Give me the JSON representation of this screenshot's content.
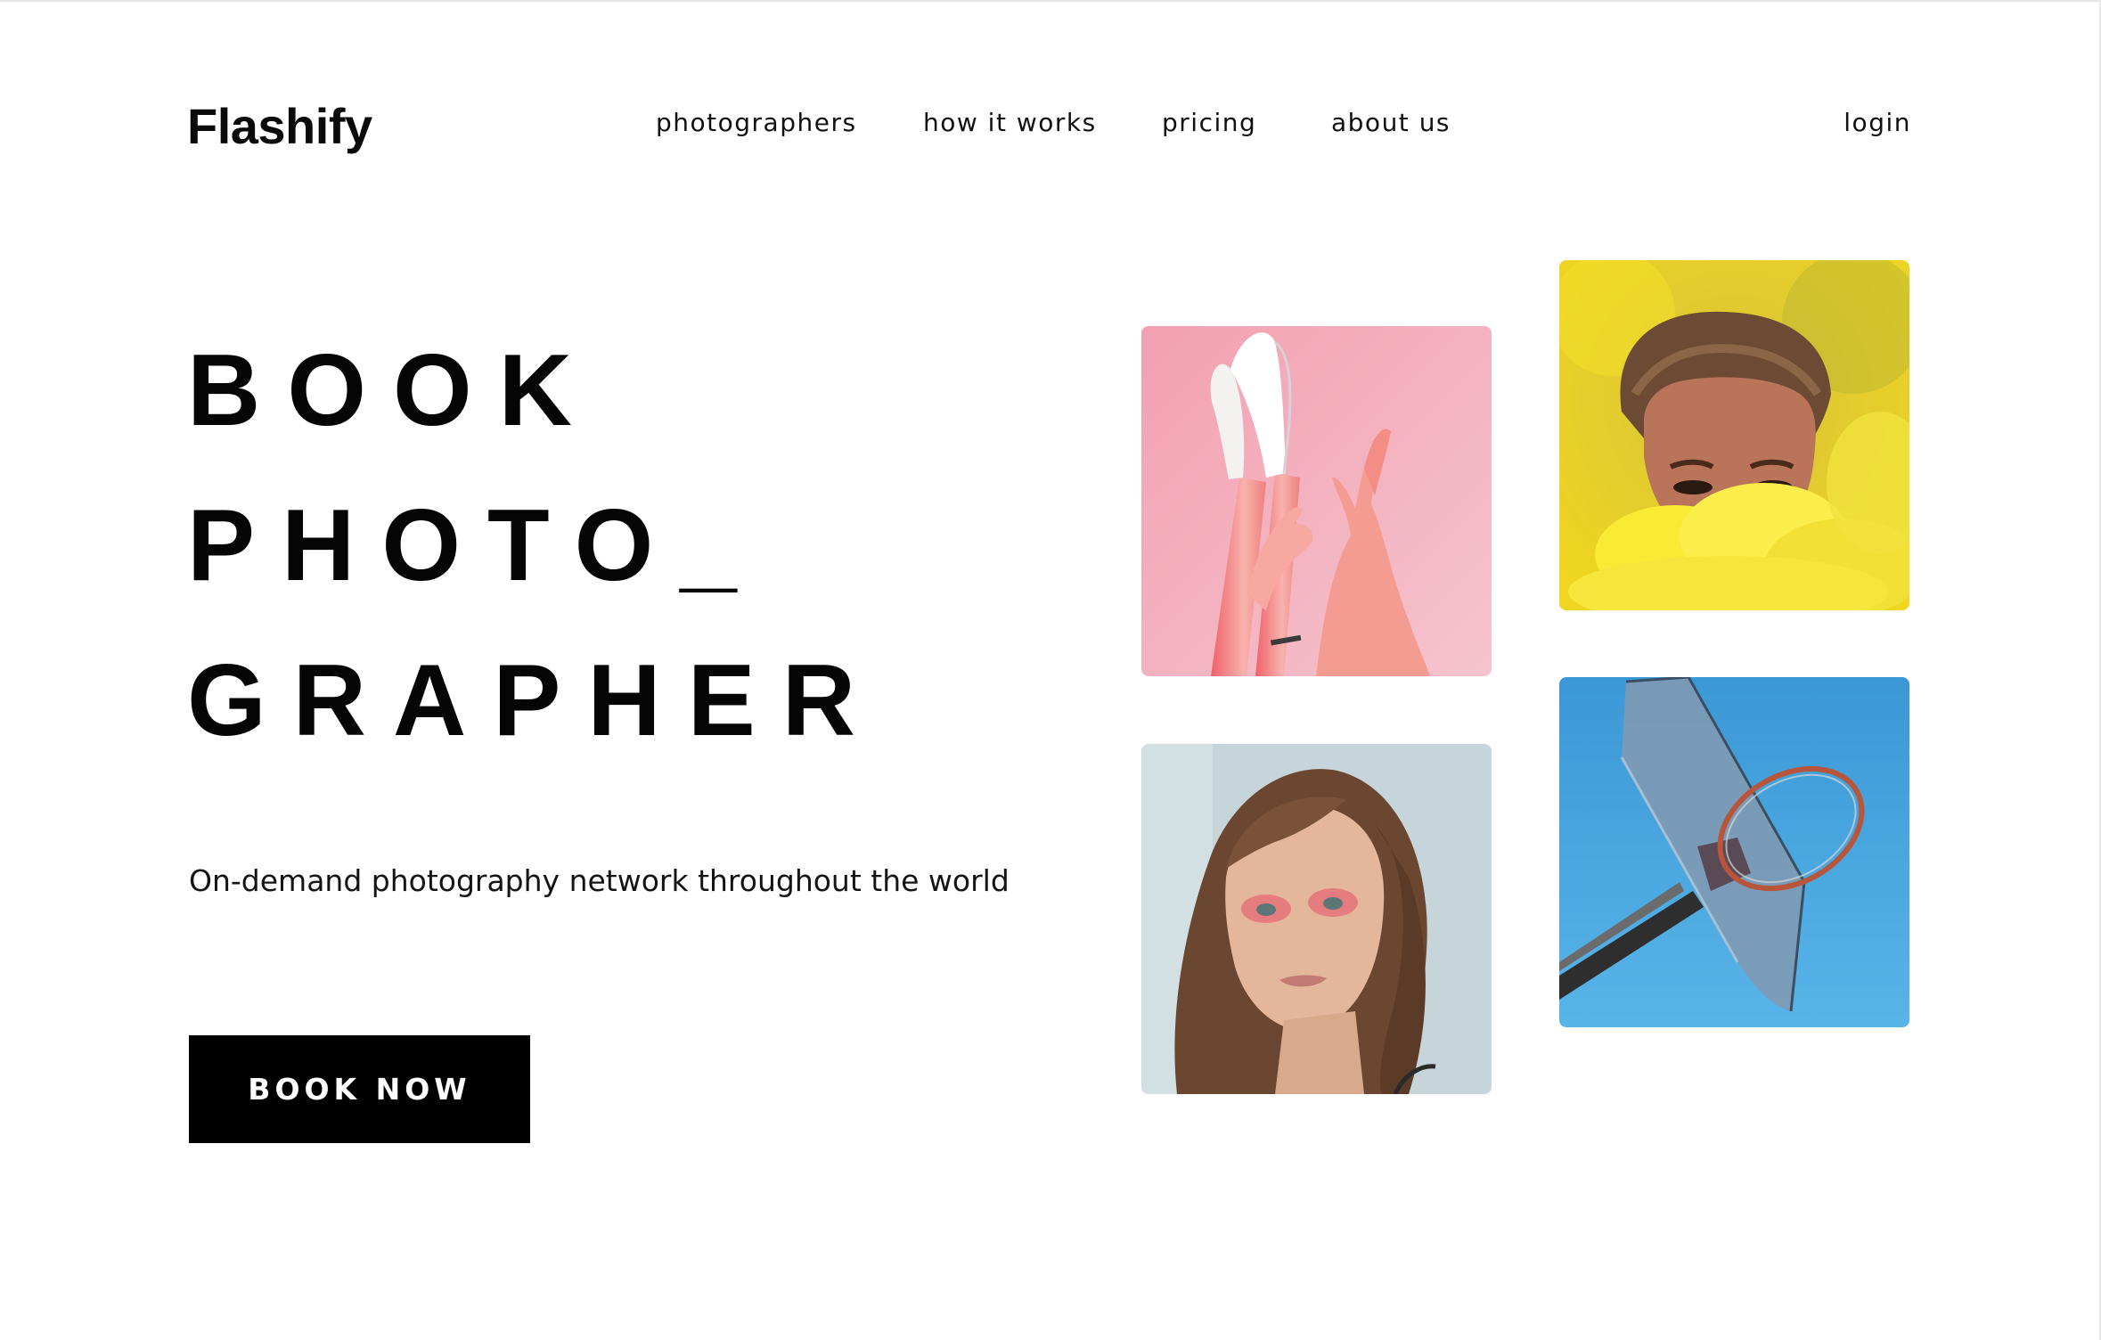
{
  "header": {
    "logo": "Flashify",
    "nav": [
      {
        "label": "photographers"
      },
      {
        "label": "how it works"
      },
      {
        "label": "pricing"
      },
      {
        "label": "about us"
      }
    ],
    "login_label": "login"
  },
  "hero": {
    "headline_lines": [
      "BOOK",
      "PHOTO_",
      "GRAPHER"
    ],
    "tagline": "On-demand photography network throughout the world",
    "cta_label": "BOOK NOW"
  },
  "gallery": {
    "photos": [
      {
        "subject": "legs-sneakers-hands-photo",
        "background": "#f0a6b6"
      },
      {
        "subject": "man-yellow-smoke-photo",
        "background": "#e8cf2a"
      },
      {
        "subject": "woman-portrait-photo",
        "background": "#c4d3d8"
      },
      {
        "subject": "basketball-hoop-photo",
        "background": "#3d9fdc"
      }
    ]
  },
  "colors": {
    "text": "#0b0b0b",
    "background": "#ffffff",
    "button": "#000000",
    "button_text": "#ffffff"
  }
}
